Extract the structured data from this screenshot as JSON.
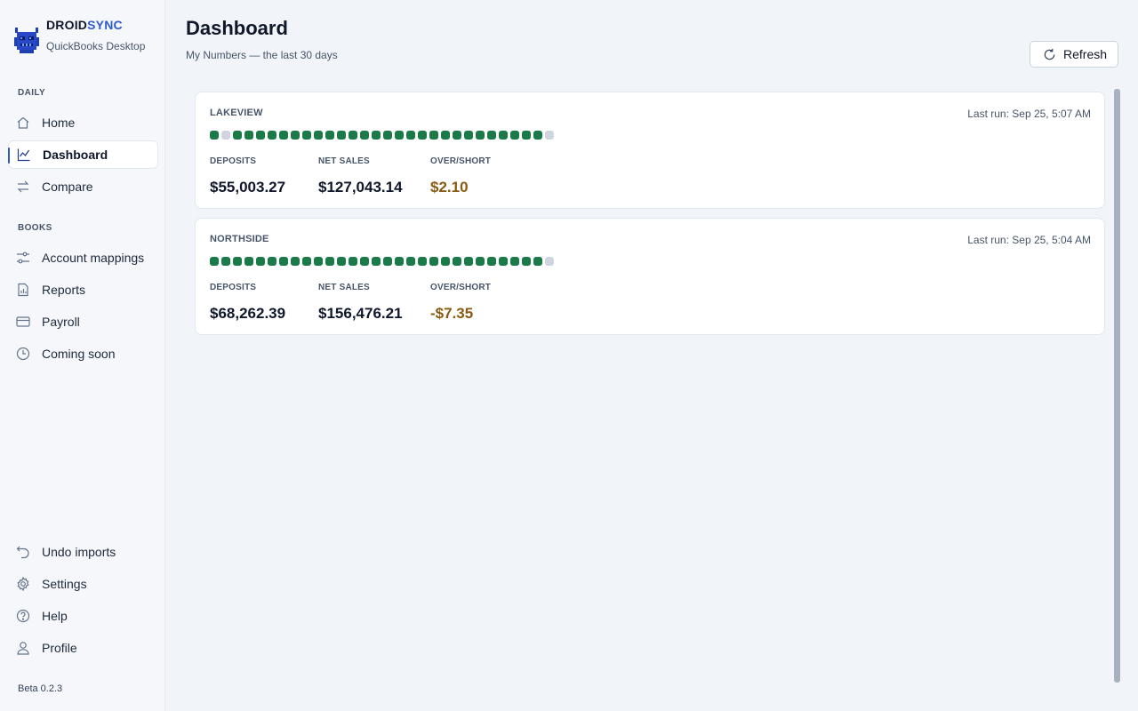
{
  "brand": {
    "name_part1": "DROID",
    "name_part2": "SYNC",
    "subtitle": "QuickBooks Desktop"
  },
  "sidebar": {
    "sections": [
      {
        "label": "DAILY",
        "items": [
          {
            "label": "Home",
            "icon": "home-icon"
          },
          {
            "label": "Dashboard",
            "icon": "chart-icon",
            "active": true
          },
          {
            "label": "Compare",
            "icon": "swap-icon"
          }
        ]
      },
      {
        "label": "BOOKS",
        "items": [
          {
            "label": "Account mappings",
            "icon": "sliders-icon"
          },
          {
            "label": "Reports",
            "icon": "report-icon"
          },
          {
            "label": "Payroll",
            "icon": "card-icon"
          },
          {
            "label": "Coming soon",
            "icon": "clock-icon"
          }
        ]
      }
    ],
    "bottom_items": [
      {
        "label": "Undo imports",
        "icon": "undo-icon"
      },
      {
        "label": "Settings",
        "icon": "gear-icon"
      },
      {
        "label": "Help",
        "icon": "help-icon"
      },
      {
        "label": "Profile",
        "icon": "user-icon"
      }
    ],
    "version": "Beta 0.2.3"
  },
  "header": {
    "title": "Dashboard",
    "subtitle": "My Numbers — the last 30 days",
    "refresh_label": "Refresh"
  },
  "colors": {
    "accent": "#2f5bd1",
    "dot_ok": "#1a7a48",
    "dot_missing": "#cfd5de",
    "over_short": "#8a5a12"
  },
  "stores": [
    {
      "name": "LAKEVIEW",
      "last_run": "Last run: Sep 25, 5:07 AM",
      "days": [
        1,
        0,
        1,
        1,
        1,
        1,
        1,
        1,
        1,
        1,
        1,
        1,
        1,
        1,
        1,
        1,
        1,
        1,
        1,
        1,
        1,
        1,
        1,
        1,
        1,
        1,
        1,
        1,
        1,
        0
      ],
      "metrics": [
        {
          "label": "DEPOSITS",
          "value": "$55,003.27"
        },
        {
          "label": "NET SALES",
          "value": "$127,043.14"
        },
        {
          "label": "OVER/SHORT",
          "value": "$2.10",
          "warn": true
        }
      ]
    },
    {
      "name": "NORTHSIDE",
      "last_run": "Last run: Sep 25, 5:04 AM",
      "days": [
        1,
        1,
        1,
        1,
        1,
        1,
        1,
        1,
        1,
        1,
        1,
        1,
        1,
        1,
        1,
        1,
        1,
        1,
        1,
        1,
        1,
        1,
        1,
        1,
        1,
        1,
        1,
        1,
        1,
        0
      ],
      "metrics": [
        {
          "label": "DEPOSITS",
          "value": "$68,262.39"
        },
        {
          "label": "NET SALES",
          "value": "$156,476.21"
        },
        {
          "label": "OVER/SHORT",
          "value": "-$7.35",
          "warn": true
        }
      ]
    }
  ]
}
